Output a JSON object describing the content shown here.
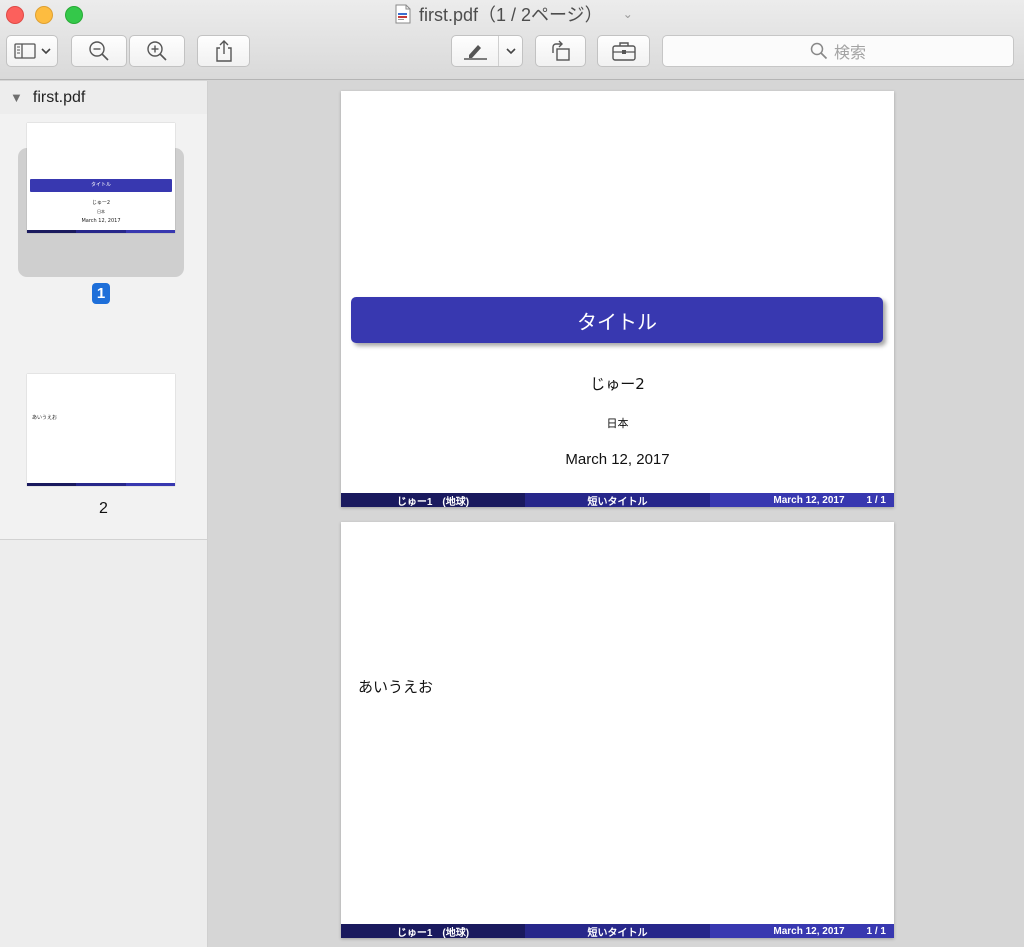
{
  "window": {
    "title": "first.pdf（1 / 2ページ）"
  },
  "toolbar": {
    "search_placeholder": "検索"
  },
  "sidebar": {
    "document_name": "first.pdf",
    "thumbnails": [
      {
        "page_label": "1",
        "selected": true
      },
      {
        "page_label": "2",
        "selected": false
      }
    ]
  },
  "pages": [
    {
      "title": "タイトル",
      "author": "じゅー2",
      "institute": "日本",
      "date": "March 12, 2017",
      "footer": {
        "left": "じゅー1　(地球)",
        "center": "短いタイトル",
        "date": "March 12, 2017",
        "pages": "1 / 1"
      }
    },
    {
      "body": "あいうえお",
      "footer": {
        "left": "じゅー1　(地球)",
        "center": "短いタイトル",
        "date": "March 12, 2017",
        "pages": "1 / 1"
      }
    }
  ],
  "colors": {
    "slide_blue": "#3838b0",
    "footer_dark": "#1a1a5e",
    "footer_mid": "#27278a",
    "selection_badge": "#1e6fd9"
  }
}
